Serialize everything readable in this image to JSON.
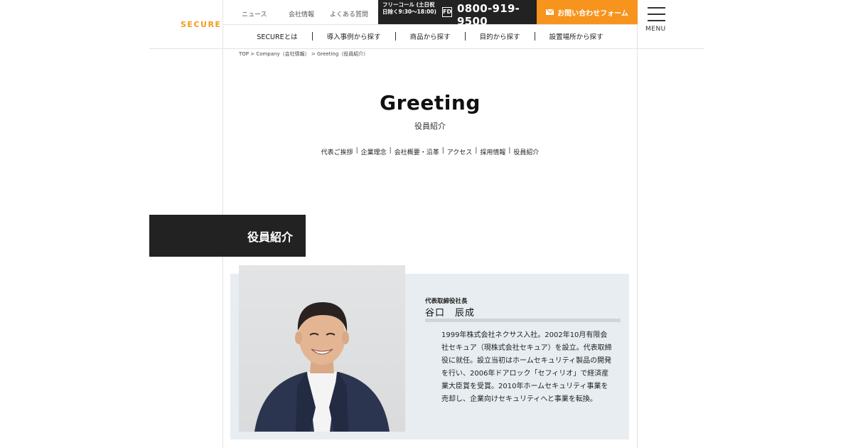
{
  "header": {
    "logo": "SECURE",
    "util_links": [
      "ニュース",
      "会社情報",
      "よくある質問"
    ],
    "freecall_label": "フリーコール (土日祝日除く9:30〜18:00)",
    "freecall_logo": "FD",
    "freecall_number": "0800-919-9500",
    "contact_label": "お問い合わせフォーム",
    "menu_label": "MENU"
  },
  "nav": [
    "SECUREとは",
    "導入事例から探す",
    "商品から探す",
    "目的から探す",
    "設置場所から探す"
  ],
  "breadcrumb": "TOP > Company（会社情報） > Greeting（役員紹介）",
  "page": {
    "title": "Greeting",
    "subtitle": "役員紹介",
    "subnav": [
      "代表ご挨拶",
      "企業理念",
      "会社概要・沿革",
      "アクセス",
      "採用情報",
      "役員紹介"
    ]
  },
  "section": {
    "heading": "役員紹介"
  },
  "profile": {
    "role": "代表取締役社長",
    "name": "谷口　辰成",
    "bio": "1999年株式会社ネクサス入社。2002年10月有限会社セキュア（現株式会社セキュア）を設立。代表取締役に就任。設立当初はホームセキュリティ製品の開発を行い、2006年ドアロック「セフィリオ」で経済産業大臣賞を受賞。2010年ホームセキュリティ事業を売却し、企業向けセキュリティへと事業を転換。"
  },
  "colors": {
    "accent_orange": "#f7941d",
    "dark": "#222222",
    "card_bg": "#e7edf0"
  }
}
